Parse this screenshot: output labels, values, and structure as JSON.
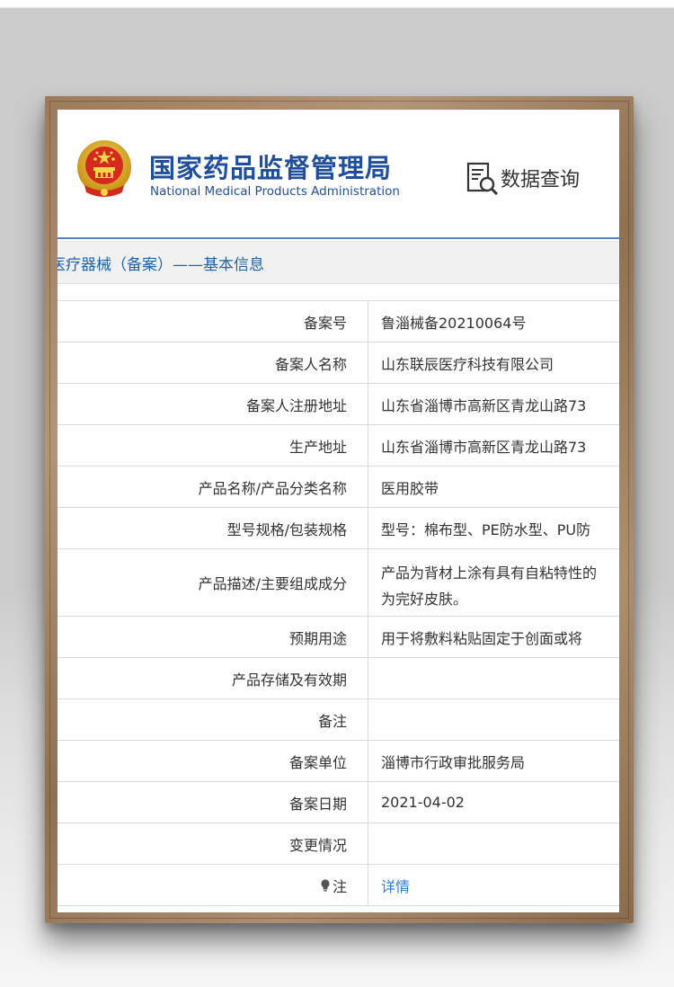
{
  "header": {
    "agency_name_cn": "国家药品监督管理局",
    "agency_name_en": "National Medical Products Administration",
    "query_label": "数据查询"
  },
  "title_bar": {
    "text": "医疗器械（备案）——基本信息"
  },
  "rows": [
    {
      "label": "备案号",
      "value": "鲁淄械备20210064号"
    },
    {
      "label": "备案人名称",
      "value": "山东联辰医疗科技有限公司"
    },
    {
      "label": "备案人注册地址",
      "value": "山东省淄博市高新区青龙山路73"
    },
    {
      "label": "生产地址",
      "value": "山东省淄博市高新区青龙山路73"
    },
    {
      "label": "产品名称/产品分类名称",
      "value": "医用胶带"
    },
    {
      "label": "型号规格/包装规格",
      "value": "型号：棉布型、PE防水型、PU防"
    },
    {
      "label": "产品描述/主要组成成分",
      "value_line1": "产品为背材上涂有具有自粘特性的",
      "value_line2": "为完好皮肤。"
    },
    {
      "label": "预期用途",
      "value": "用于将敷料粘贴固定于创面或将"
    },
    {
      "label": "产品存储及有效期",
      "value": ""
    },
    {
      "label": "备注",
      "value": ""
    },
    {
      "label": "备案单位",
      "value": "淄博市行政审批服务局"
    },
    {
      "label": "备案日期",
      "value": "2021-04-02"
    },
    {
      "label": "变更情况",
      "value": ""
    },
    {
      "label": "注",
      "value": "详情"
    }
  ],
  "colors": {
    "brand_blue": "#1f4f9c",
    "link_blue": "#2b7bd1",
    "frame_wood": "#9c7b5c"
  },
  "icons": [
    "national-emblem-icon",
    "data-query-icon",
    "lightbulb-icon"
  ]
}
